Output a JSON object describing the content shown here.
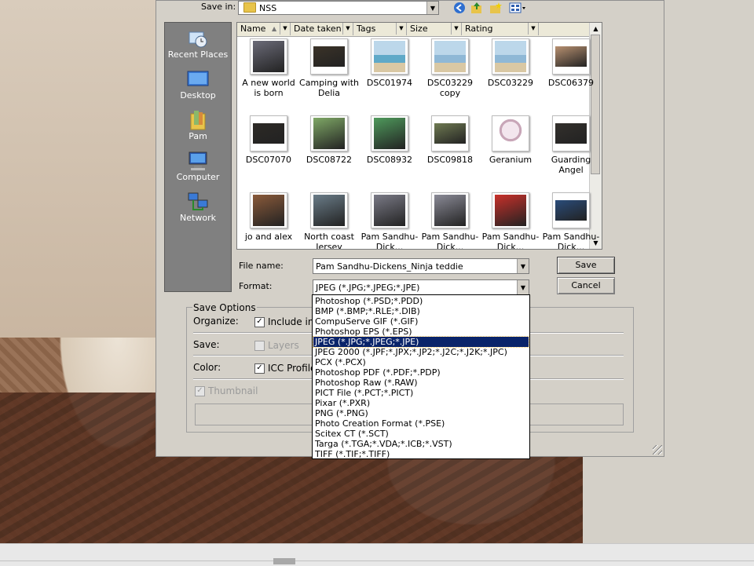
{
  "dialog": {
    "save_in_label": "Save in:",
    "save_in_value": "NSS",
    "file_name_label": "File name:",
    "file_name_value": "Pam Sandhu-Dickens_Ninja teddie",
    "format_label": "Format:",
    "format_value": "JPEG (*.JPG;*.JPEG;*.JPE)",
    "save_button": "Save",
    "cancel_button": "Cancel"
  },
  "places": [
    {
      "label": "Recent Places",
      "icon": "recent-places-icon"
    },
    {
      "label": "Desktop",
      "icon": "desktop-icon"
    },
    {
      "label": "Pam",
      "icon": "user-folder-icon"
    },
    {
      "label": "Computer",
      "icon": "computer-icon"
    },
    {
      "label": "Network",
      "icon": "network-icon"
    }
  ],
  "columns": [
    {
      "label": "Name",
      "sorted": true
    },
    {
      "label": "Date taken"
    },
    {
      "label": "Tags"
    },
    {
      "label": "Size"
    },
    {
      "label": "Rating"
    }
  ],
  "files": [
    {
      "name": "A new world is born",
      "thumb": "#6b6b78"
    },
    {
      "name": "Camping with Delia",
      "thumb": "#3b3328"
    },
    {
      "name": "DSC01974",
      "thumb": "#5fa9c8"
    },
    {
      "name": "DSC03229 copy",
      "thumb": "#8fb8d6"
    },
    {
      "name": "DSC03229",
      "thumb": "#8fb8d6"
    },
    {
      "name": "DSC06379",
      "thumb": "#b79070"
    },
    {
      "name": "DSC07070",
      "thumb": "#2d2a26"
    },
    {
      "name": "DSC08722",
      "thumb": "#7fa866"
    },
    {
      "name": "DSC08932",
      "thumb": "#4f9a5c"
    },
    {
      "name": "DSC09818",
      "thumb": "#6f7a52"
    },
    {
      "name": "Geranium",
      "thumb": "#e6d4dc"
    },
    {
      "name": "Guarding Angel",
      "thumb": "#33302c"
    },
    {
      "name": "jo and alex",
      "thumb": "#8a5a3a"
    },
    {
      "name": "North coast Jersey",
      "thumb": "#6a7c88"
    },
    {
      "name": "Pam Sandhu-Dick...",
      "thumb": "#7a7a86"
    },
    {
      "name": "Pam Sandhu-Dick...",
      "thumb": "#8a8a96"
    },
    {
      "name": "Pam Sandhu-Dick...",
      "thumb": "#c8302a"
    },
    {
      "name": "Pam Sandhu-Dick...",
      "thumb": "#2a4c7a"
    }
  ],
  "save_options": {
    "title": "Save Options",
    "organize_label": "Organize:",
    "organize_check": "Include in",
    "save_label": "Save:",
    "save_check": "Layers",
    "color_label": "Color:",
    "color_check": "ICC Profile",
    "thumbnail_check": "Thumbnail"
  },
  "format_options": [
    "Photoshop (*.PSD;*.PDD)",
    "BMP (*.BMP;*.RLE;*.DIB)",
    "CompuServe GIF (*.GIF)",
    "Photoshop EPS (*.EPS)",
    "JPEG (*.JPG;*.JPEG;*.JPE)",
    "JPEG 2000 (*.JPF;*.JPX;*.JP2;*.J2C;*.J2K;*.JPC)",
    "PCX (*.PCX)",
    "Photoshop PDF (*.PDF;*.PDP)",
    "Photoshop Raw (*.RAW)",
    "PICT File (*.PCT;*.PICT)",
    "Pixar (*.PXR)",
    "PNG (*.PNG)",
    "Photo Creation Format (*.PSE)",
    "Scitex CT (*.SCT)",
    "Targa (*.TGA;*.VDA;*.ICB;*.VST)",
    "TIFF (*.TIF;*.TIFF)"
  ],
  "selected_format_index": 4,
  "colors": {
    "dialog_bg": "#d4d0c8",
    "selection": "#0a246a",
    "places_bg": "#808080"
  }
}
